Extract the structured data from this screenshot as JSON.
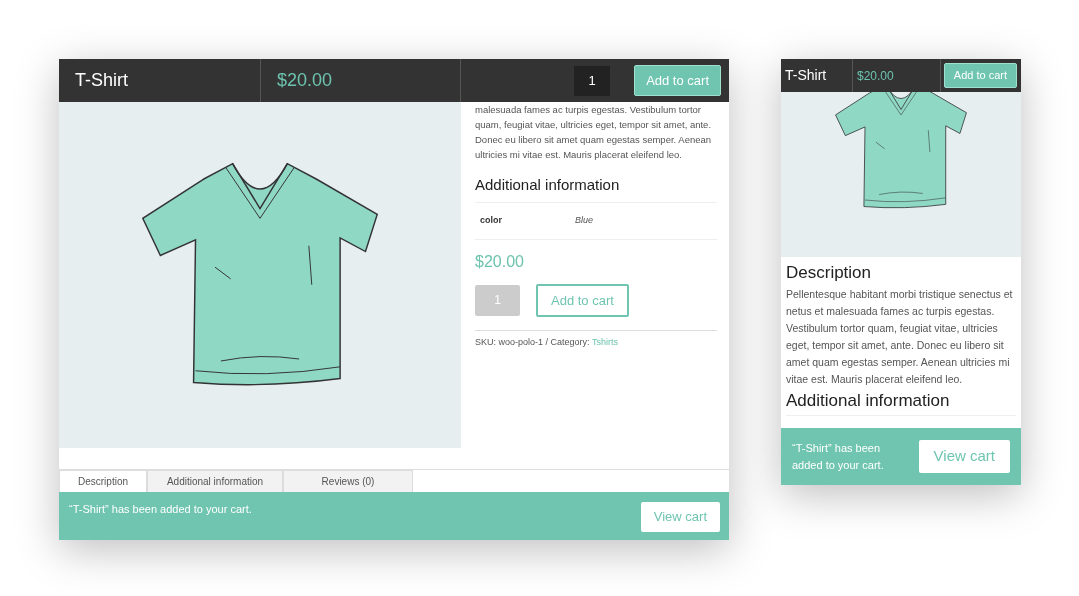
{
  "desktop": {
    "header": {
      "title": "T-Shirt",
      "price": "$20.00",
      "quantity": "1",
      "button": "Add to cart"
    },
    "description": "malesuada fames ac turpis egestas. Vestibulum tortor quam, feugiat vitae, ultricies eget, tempor sit amet, ante. Donec eu libero sit amet quam egestas semper. Aenean ultricies mi vitae est. Mauris placerat eleifend leo.",
    "additional_heading": "Additional information",
    "attributes": [
      {
        "name": "color",
        "value": "Blue"
      }
    ],
    "price": "$20.00",
    "quantity": "1",
    "button": "Add to cart",
    "meta": "SKU: woo-polo-1 / Category: ",
    "category": "Tshirts",
    "tabs": [
      {
        "label": "Description",
        "selected": true
      },
      {
        "label": "Additional information",
        "selected": false
      },
      {
        "label": "Reviews (0)",
        "selected": false
      }
    ],
    "notice": {
      "message": "“T-Shirt” has been added to your cart.",
      "button": "View cart"
    }
  },
  "mobile": {
    "header": {
      "title": "T-Shirt",
      "price": "$20.00",
      "button": "Add to cart"
    },
    "description_heading": "Description",
    "description": "Pellentesque habitant morbi tristique senectus et netus et malesuada fames ac turpis egestas. Vestibulum tortor quam, feugiat vitae, ultricies eget, tempor sit amet, ante. Donec eu libero sit amet quam egestas semper. Aenean ultricies mi vitae est. Mauris placerat eleifend leo.",
    "additional_heading": "Additional information",
    "notice": {
      "message": "“T-Shirt” has been added to your cart.",
      "button": "View cart"
    }
  }
}
